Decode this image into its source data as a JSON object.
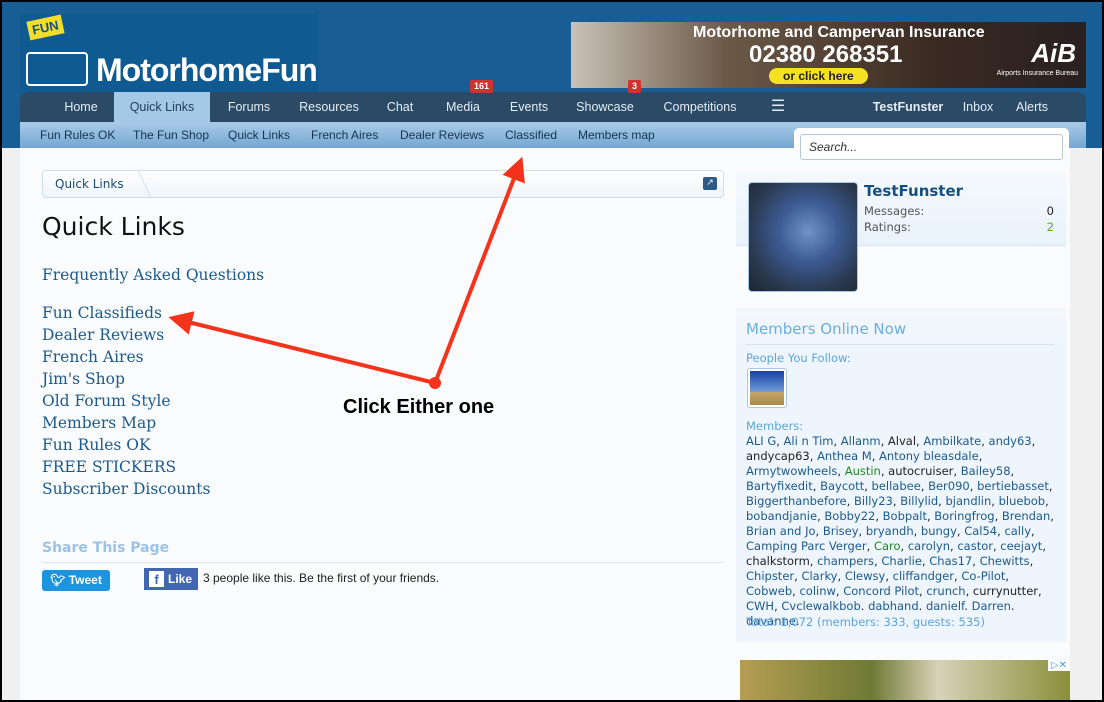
{
  "header": {
    "logo_badge": "FUN",
    "logo_text": "MotorhomeFun",
    "ad": {
      "title": "Motorhome and Campervan Insurance",
      "phone": "02380 268351",
      "cta": "or click here",
      "brand": "AiB",
      "brand_sub": "Airports Insurance Bureau"
    }
  },
  "nav": {
    "items": [
      {
        "label": "Home"
      },
      {
        "label": "Quick Links",
        "active": true
      },
      {
        "label": "Forums"
      },
      {
        "label": "Resources"
      },
      {
        "label": "Chat"
      },
      {
        "label": "Media",
        "badge": "161"
      },
      {
        "label": "Events"
      },
      {
        "label": "Showcase",
        "badge": "3"
      },
      {
        "label": "Competitions"
      }
    ],
    "menu_icon": "hamburger-icon",
    "user": "TestFunster",
    "inbox": "Inbox",
    "alerts": "Alerts"
  },
  "subnav": [
    "Fun Rules OK",
    "The Fun Shop",
    "Quick Links",
    "French Aires",
    "Dealer Reviews",
    "Classified",
    "Members map"
  ],
  "search": {
    "placeholder": "Search..."
  },
  "breadcrumb": {
    "item": "Quick Links"
  },
  "page_title": "Quick Links",
  "links": {
    "faq": "Frequently Asked Questions",
    "list": [
      "Fun Classifieds",
      "Dealer Reviews",
      "French Aires",
      "Jim's Shop",
      "Old Forum Style",
      "Members Map",
      "Fun Rules OK",
      "FREE STICKERS",
      "Subscriber Discounts"
    ]
  },
  "share": {
    "title": "Share This Page",
    "tweet": "Tweet",
    "like": "Like",
    "like_text": "3 people like this. Be the first of your friends."
  },
  "profile": {
    "name": "TestFunster",
    "messages_label": "Messages:",
    "messages": "0",
    "ratings_label": "Ratings:",
    "ratings": "2",
    "ratings_color": "#5aa820"
  },
  "online": {
    "title": "Members Online Now",
    "people_follow": "People You Follow:",
    "members_label": "Members:",
    "members": [
      {
        "n": "ALI G"
      },
      {
        "n": "Ali n Tim"
      },
      {
        "n": "Allanm"
      },
      {
        "n": "Alval",
        "c": "black"
      },
      {
        "n": "Ambilkate"
      },
      {
        "n": "andy63"
      },
      {
        "n": "andycap63",
        "c": "black"
      },
      {
        "n": "Anthea M"
      },
      {
        "n": "Antony bleasdale"
      },
      {
        "n": "Armytwowheels"
      },
      {
        "n": "Austin",
        "c": "green"
      },
      {
        "n": "autocruiser",
        "c": "black"
      },
      {
        "n": "Bailey58"
      },
      {
        "n": "Bartyfixedit"
      },
      {
        "n": "Baycott"
      },
      {
        "n": "bellabee"
      },
      {
        "n": "Ber090"
      },
      {
        "n": "bertiebasset"
      },
      {
        "n": "Biggerthanbefore"
      },
      {
        "n": "Billy23"
      },
      {
        "n": "Billylid"
      },
      {
        "n": "bjandlin"
      },
      {
        "n": "bluebob"
      },
      {
        "n": "bobandjanie"
      },
      {
        "n": "Bobby22"
      },
      {
        "n": "Bobpalt"
      },
      {
        "n": "Boringfrog"
      },
      {
        "n": "Brendan"
      },
      {
        "n": "Brian and Jo"
      },
      {
        "n": "Brisey"
      },
      {
        "n": "bryandh"
      },
      {
        "n": "bungy"
      },
      {
        "n": "Cal54"
      },
      {
        "n": "cally"
      },
      {
        "n": "Camping Parc Verger"
      },
      {
        "n": "Caro",
        "c": "green"
      },
      {
        "n": "carolyn"
      },
      {
        "n": "castor"
      },
      {
        "n": "ceejayt"
      },
      {
        "n": "chalkstorm",
        "c": "black"
      },
      {
        "n": "champers"
      },
      {
        "n": "Charlie"
      },
      {
        "n": "Chas17"
      },
      {
        "n": "Chewitts"
      },
      {
        "n": "Chipster"
      },
      {
        "n": "Clarky"
      },
      {
        "n": "Clewsy"
      },
      {
        "n": "cliffandger"
      },
      {
        "n": "Co-Pilot"
      },
      {
        "n": "Cobweb"
      },
      {
        "n": "colinw"
      },
      {
        "n": "Concord Pilot"
      },
      {
        "n": "crunch"
      },
      {
        "n": "currynutter",
        "c": "black"
      },
      {
        "n": "CWH"
      },
      {
        "n": "Cvclewalkbob"
      },
      {
        "n": "dabhand"
      },
      {
        "n": "danielf"
      },
      {
        "n": "Darren"
      },
      {
        "n": "davanne"
      }
    ],
    "total": "Total: 1,072 (members: 333, guests: 535)"
  },
  "annotation": {
    "text": "Click Either one",
    "color": "#f5331c"
  }
}
